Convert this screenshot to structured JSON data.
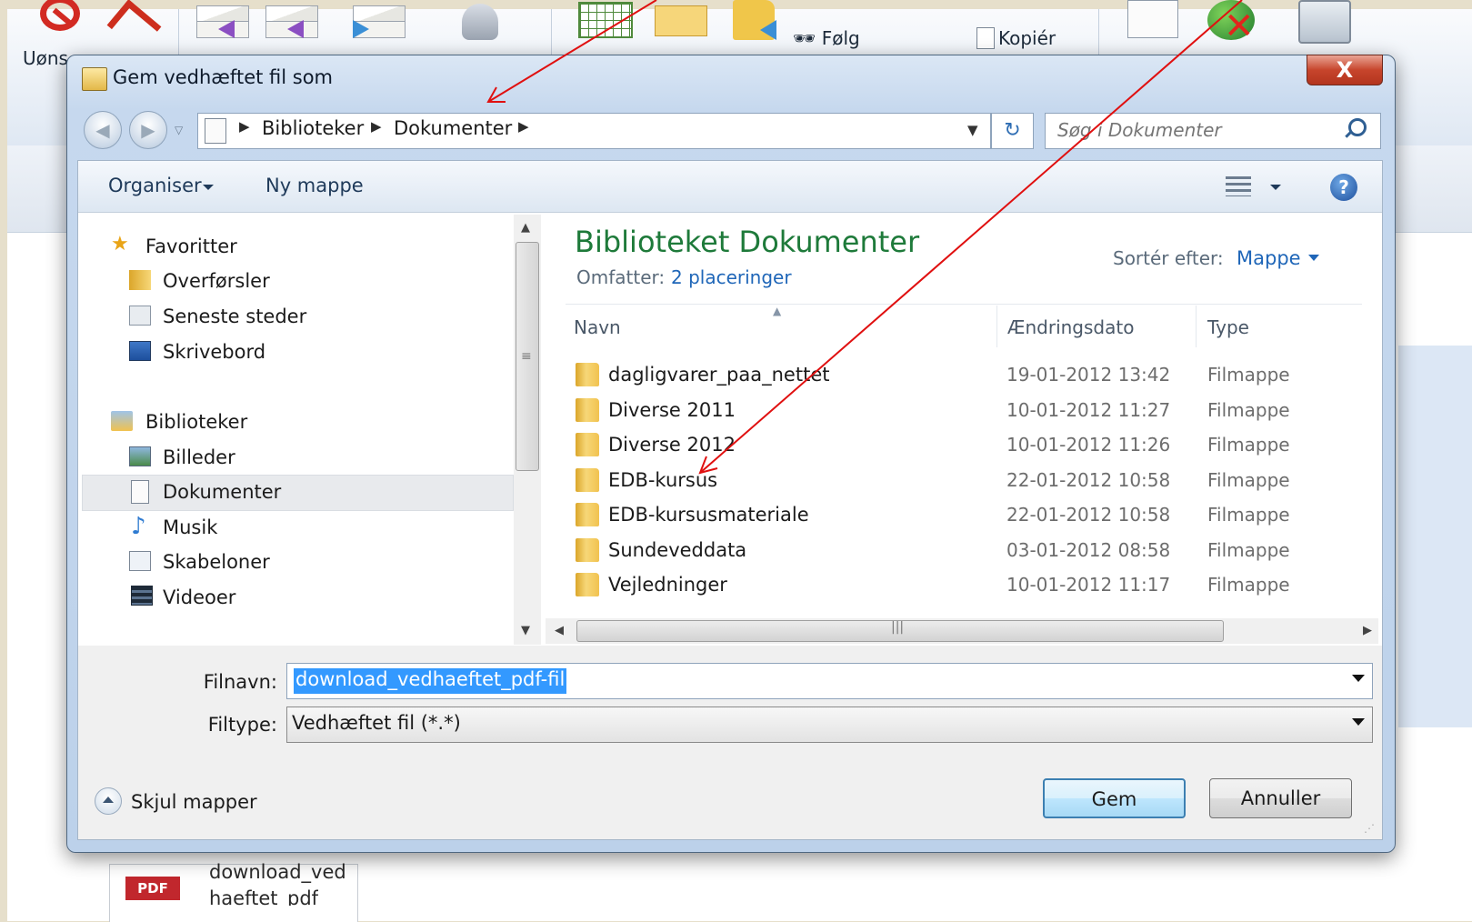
{
  "background_app": {
    "ribbon": {
      "folg_label": "Følg",
      "copy_label": "Kopiér",
      "uonsket_label": "Uøns"
    },
    "attachment": {
      "badge": "PDF",
      "name_line1": "download_ved",
      "name_line2": "haeftet_pdf"
    }
  },
  "dialog": {
    "title": "Gem vedhæftet fil som",
    "close_label": "X",
    "nav": {
      "back_label": "◀",
      "forward_label": "▶",
      "breadcrumb": [
        "Biblioteker",
        "Dokumenter"
      ],
      "search_placeholder": "Søg i Dokumenter"
    },
    "toolbar": {
      "organize_label": "Organiser",
      "new_folder_label": "Ny mappe",
      "help_label": "?"
    },
    "nav_pane": {
      "favorites": {
        "label": "Favoritter",
        "items": [
          "Overførsler",
          "Seneste steder",
          "Skrivebord"
        ]
      },
      "libraries": {
        "label": "Biblioteker",
        "items": [
          "Billeder",
          "Dokumenter",
          "Musik",
          "Skabeloner",
          "Videoer"
        ],
        "selected": "Dokumenter"
      }
    },
    "content": {
      "library_title": "Biblioteket Dokumenter",
      "includes_label": "Omfatter:",
      "includes_link": "2 placeringer",
      "sort_label": "Sortér efter:",
      "sort_value": "Mappe",
      "columns": [
        "Navn",
        "Ændringsdato",
        "Type"
      ],
      "rows": [
        {
          "name": "dagligvarer_paa_nettet",
          "date": "19-01-2012 13:42",
          "type": "Filmappe"
        },
        {
          "name": "Diverse 2011",
          "date": "10-01-2012 11:27",
          "type": "Filmappe"
        },
        {
          "name": "Diverse 2012",
          "date": "10-01-2012 11:26",
          "type": "Filmappe"
        },
        {
          "name": "EDB-kursus",
          "date": "22-01-2012 10:58",
          "type": "Filmappe"
        },
        {
          "name": "EDB-kursusmateriale",
          "date": "22-01-2012 10:58",
          "type": "Filmappe"
        },
        {
          "name": "Sundeveddata",
          "date": "03-01-2012 08:58",
          "type": "Filmappe"
        },
        {
          "name": "Vejledninger",
          "date": "10-01-2012 11:17",
          "type": "Filmappe"
        }
      ]
    },
    "form": {
      "filename_label": "Filnavn:",
      "filename_value": "download_vedhaeftet_pdf-fil",
      "filetype_label": "Filtype:",
      "filetype_value": "Vedhæftet fil (*.*)"
    },
    "footer": {
      "hide_folders_label": "Skjul mapper",
      "save_label": "Gem",
      "cancel_label": "Annuller"
    }
  },
  "colors": {
    "accent_green": "#1e7a3a",
    "link_blue": "#1f66b8",
    "annotation_red": "#e01010",
    "selection_blue": "#3399ff"
  }
}
